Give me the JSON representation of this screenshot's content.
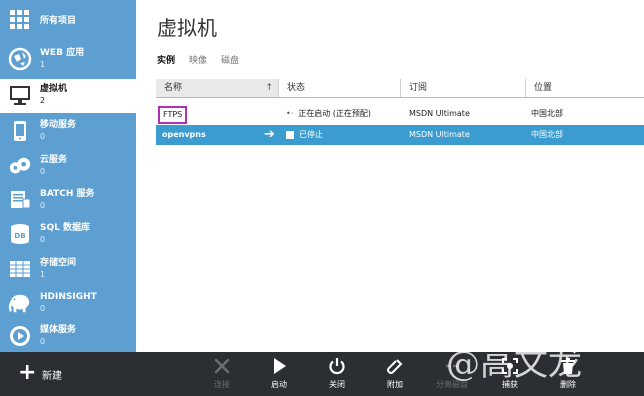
{
  "sidebar": {
    "items": [
      {
        "label": "所有项目",
        "count": ""
      },
      {
        "label": "WEB 应用",
        "count": "1"
      },
      {
        "label": "虚拟机",
        "count": "2"
      },
      {
        "label": "移动服务",
        "count": "0"
      },
      {
        "label": "云服务",
        "count": "0"
      },
      {
        "label": "BATCH 服务",
        "count": "0"
      },
      {
        "label": "SQL 数据库",
        "count": "0"
      },
      {
        "label": "存储空间",
        "count": "1"
      },
      {
        "label": "HDINSIGHT",
        "count": "0"
      },
      {
        "label": "媒体服务",
        "count": "0"
      }
    ]
  },
  "main": {
    "title": "虚拟机",
    "tabs": [
      {
        "label": "实例"
      },
      {
        "label": "映像"
      },
      {
        "label": "磁盘"
      }
    ],
    "columns": [
      {
        "label": "名称",
        "sort": "↑"
      },
      {
        "label": "状态"
      },
      {
        "label": "订阅"
      },
      {
        "label": "位置"
      }
    ],
    "rows": [
      {
        "name": "FTPS",
        "status": "正在启动 (正在预配)",
        "subscription": "MSDN Ultimate",
        "location": "中国北部"
      },
      {
        "name": "openvpns",
        "status": "已停止",
        "subscription": "MSDN Ultimate",
        "location": "中国北部"
      }
    ]
  },
  "commandbar": {
    "new_label": "新建",
    "buttons": [
      {
        "label": "连接",
        "icon": "connect-icon",
        "enabled": false
      },
      {
        "label": "启动",
        "icon": "play-icon",
        "enabled": true
      },
      {
        "label": "关闭",
        "icon": "power-icon",
        "enabled": true
      },
      {
        "label": "附加",
        "icon": "attach-icon",
        "enabled": true
      },
      {
        "label": "分离磁盘",
        "icon": "detach-icon",
        "enabled": false
      },
      {
        "label": "捕获",
        "icon": "capture-icon",
        "enabled": true
      },
      {
        "label": "删除",
        "icon": "trash-icon",
        "enabled": true
      }
    ]
  },
  "watermark": "@高文龙",
  "colors": {
    "sidebar": "#5c9fd0",
    "selected_row": "#3a9ccf",
    "command_bar": "#2b2e33",
    "highlight_box": "#b030b8"
  }
}
